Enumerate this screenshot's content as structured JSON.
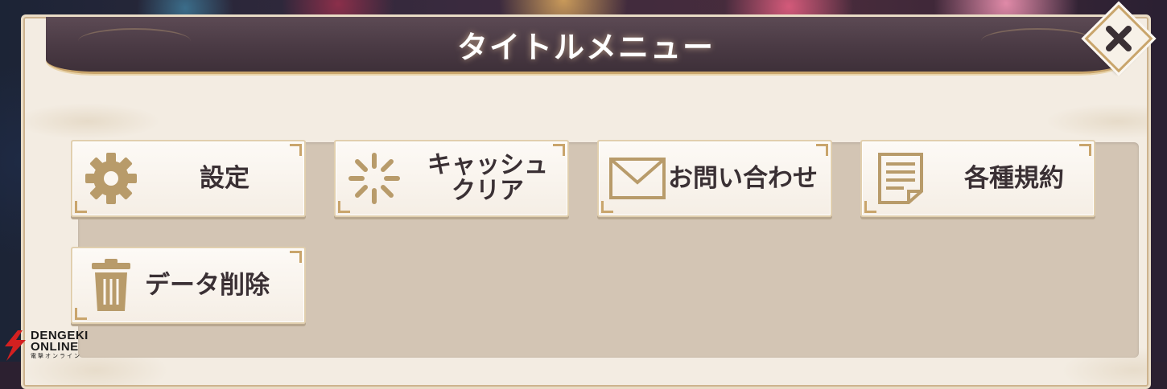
{
  "dialog": {
    "title": "タイトルメニュー",
    "close_icon": "close-icon"
  },
  "menu": {
    "items": [
      {
        "id": "settings",
        "label": "設定",
        "icon": "gear-icon"
      },
      {
        "id": "cache-clear",
        "label_line1": "キャッシュ",
        "label_line2": "クリア",
        "icon": "loading-spinner-icon"
      },
      {
        "id": "contact",
        "label": "お問い合わせ",
        "icon": "envelope-icon"
      },
      {
        "id": "terms",
        "label": "各種規約",
        "icon": "document-icon"
      },
      {
        "id": "delete-data",
        "label": "データ削除",
        "icon": "trash-icon"
      }
    ]
  },
  "watermark": {
    "line1": "DENGEKI",
    "line2": "ONLINE",
    "line3": "電撃オンライン"
  },
  "colors": {
    "accent_gold": "#c9a56c",
    "header_bg": "#4a3a44",
    "panel_bg": "#d3c5b4",
    "text_dark": "#3a3034"
  }
}
